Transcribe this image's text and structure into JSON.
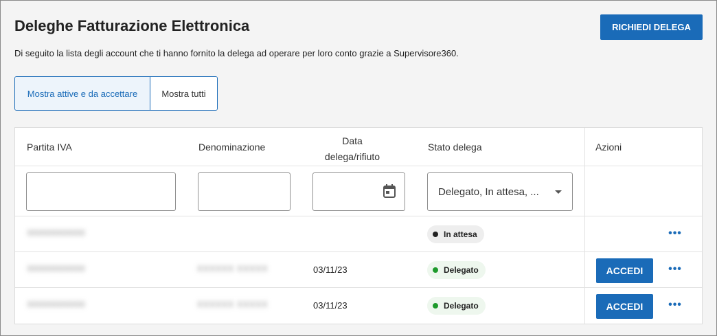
{
  "header": {
    "title": "Deleghe Fatturazione Elettronica",
    "subtitle": "Di seguito la lista degli account che ti hanno fornito la delega ad operare per loro conto grazie a Supervisore360.",
    "request_button": "RICHIEDI DELEGA"
  },
  "filters_toggle": {
    "active": "Mostra attive e da accettare",
    "all": "Mostra tutti"
  },
  "table": {
    "columns": {
      "piva": "Partita IVA",
      "denominazione": "Denominazione",
      "data_line1": "Data",
      "data_line2": "delega/rifiuto",
      "stato": "Stato delega",
      "azioni": "Azioni"
    },
    "status_filter_value": "Delegato, In attesa, ...",
    "rows": [
      {
        "piva": "00000000000",
        "denominazione": "",
        "data": "",
        "stato": "In attesa",
        "has_access": false
      },
      {
        "piva": "00000000000",
        "denominazione": "XXXXXX XXXXX",
        "data": "03/11/23",
        "stato": "Delegato",
        "has_access": true,
        "access_label": "ACCEDI"
      },
      {
        "piva": "00000000000",
        "denominazione": "XXXXXX XXXXX",
        "data": "03/11/23",
        "stato": "Delegato",
        "has_access": true,
        "access_label": "ACCEDI"
      }
    ],
    "more_label": "•••"
  },
  "colors": {
    "primary": "#1a6bb8",
    "status_waiting": "#222222",
    "status_delegated": "#1e9a2c"
  }
}
